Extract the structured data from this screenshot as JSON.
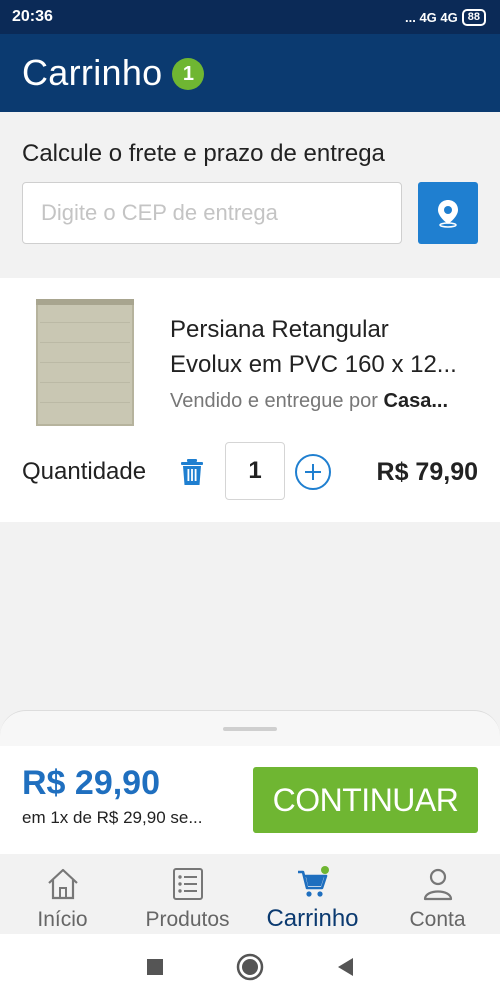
{
  "status_bar": {
    "time": "20:36",
    "indicators": "... 4G 4G",
    "battery": "88"
  },
  "header": {
    "title": "Carrinho",
    "cart_count": "1"
  },
  "shipping": {
    "title": "Calcule o frete e prazo de entrega",
    "cep_placeholder": "Digite o CEP de entrega",
    "cep_value": "",
    "locate_icon": "location-pin-icon"
  },
  "cart_item": {
    "name_line1": "Persiana Retangular",
    "name_line2": "Evolux em PVC 160 x 12...",
    "seller_prefix": "Vendido e entregue por",
    "seller_name": "Casa...",
    "quantity_label": "Quantidade",
    "quantity": "1",
    "price": "R$ 79,90",
    "icons": {
      "remove": "trash-icon",
      "increase": "plus-icon"
    }
  },
  "checkout": {
    "total": "R$ 29,90",
    "installments": "em 1x de R$ 29,90 se...",
    "continue_label": "CONTINUAR"
  },
  "bottom_nav": {
    "items": [
      {
        "label": "Início",
        "icon": "home-icon",
        "active": false
      },
      {
        "label": "Produtos",
        "icon": "list-icon",
        "active": false
      },
      {
        "label": "Carrinho",
        "icon": "cart-icon",
        "active": true
      },
      {
        "label": "Conta",
        "icon": "user-icon",
        "active": false
      }
    ]
  },
  "android_nav": {
    "icons": [
      "recents-icon",
      "home-circle-icon",
      "back-icon"
    ]
  },
  "colors": {
    "header_bg": "#0b3a70",
    "accent_blue": "#1f7fd0",
    "accent_green": "#6fb632",
    "total_blue": "#1f6fbf"
  }
}
